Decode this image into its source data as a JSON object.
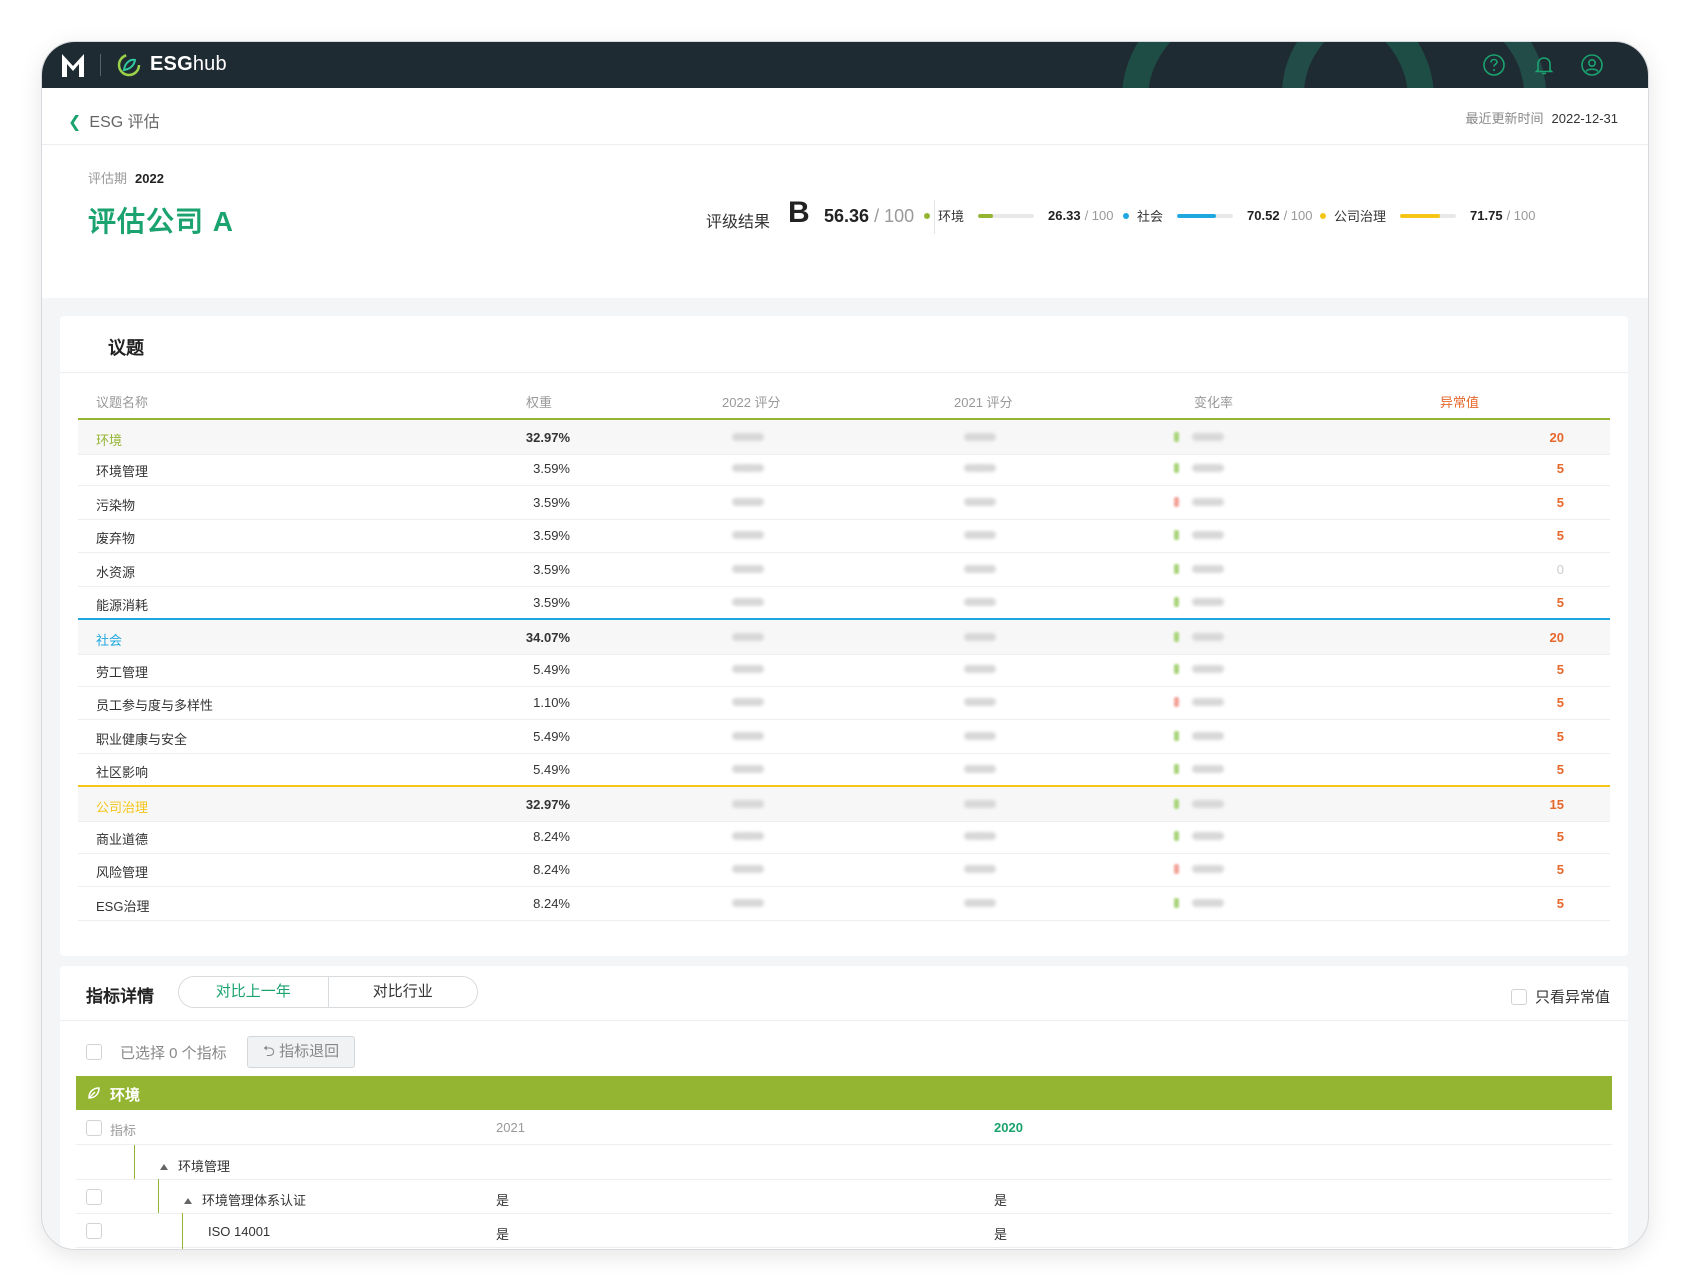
{
  "app": {
    "brand_bold": "ESG",
    "brand_light": "hub"
  },
  "topbar": {
    "icons": [
      "help-icon",
      "bell-icon",
      "user-icon"
    ]
  },
  "header": {
    "back_label": "ESG 评估",
    "updated_label": "最近更新时间",
    "updated_value": "2022-12-31",
    "period_label": "评估期",
    "period_value": "2022",
    "company": "评估公司 A",
    "rating_label": "评级结果",
    "grade": "B",
    "score": "56.36",
    "score_max": "/ 100",
    "pillars": [
      {
        "name": "环境",
        "value": "26.33",
        "max": "/ 100",
        "progress": 0.26,
        "color": "#94b531"
      },
      {
        "name": "社会",
        "value": "70.52",
        "max": "/ 100",
        "progress": 0.7,
        "color": "#1fa8e0"
      },
      {
        "name": "公司治理",
        "value": "71.75",
        "max": "/ 100",
        "progress": 0.72,
        "color": "#f5c518"
      }
    ]
  },
  "topics": {
    "title": "议题",
    "columns": [
      "议题名称",
      "权重",
      "2022 评分",
      "2021 评分",
      "变化率",
      "异常值"
    ],
    "rows": [
      {
        "name": "环境",
        "weight": "32.97%",
        "anomaly": "20",
        "group": true,
        "color": "#94b531",
        "trend": "up"
      },
      {
        "name": "环境管理",
        "weight": "3.59%",
        "anomaly": "5",
        "trend": "up"
      },
      {
        "name": "污染物",
        "weight": "3.59%",
        "anomaly": "5",
        "trend": "down"
      },
      {
        "name": "废弃物",
        "weight": "3.59%",
        "anomaly": "5",
        "trend": "up"
      },
      {
        "name": "水资源",
        "weight": "3.59%",
        "anomaly": "0",
        "trend": "up"
      },
      {
        "name": "能源消耗",
        "weight": "3.59%",
        "anomaly": "5",
        "trend": "up"
      },
      {
        "name": "社会",
        "weight": "34.07%",
        "anomaly": "20",
        "group": true,
        "color": "#1fa8e0",
        "trend": "up"
      },
      {
        "name": "劳工管理",
        "weight": "5.49%",
        "anomaly": "5",
        "trend": "up"
      },
      {
        "name": "员工参与度与多样性",
        "weight": "1.10%",
        "anomaly": "5",
        "trend": "down"
      },
      {
        "name": "职业健康与安全",
        "weight": "5.49%",
        "anomaly": "5",
        "trend": "up"
      },
      {
        "name": "社区影响",
        "weight": "5.49%",
        "anomaly": "5",
        "trend": "up"
      },
      {
        "name": "公司治理",
        "weight": "32.97%",
        "anomaly": "15",
        "group": true,
        "color": "#f5c518",
        "trend": "up"
      },
      {
        "name": "商业道德",
        "weight": "8.24%",
        "anomaly": "5",
        "trend": "up"
      },
      {
        "name": "风险管理",
        "weight": "8.24%",
        "anomaly": "5",
        "trend": "down"
      },
      {
        "name": "ESG治理",
        "weight": "8.24%",
        "anomaly": "5",
        "trend": "up"
      }
    ]
  },
  "indicators": {
    "title": "指标详情",
    "tabs": [
      "对比上一年",
      "对比行业"
    ],
    "active_tab": 0,
    "only_abnormal_label": "只看异常值",
    "selected_text": "已选择 0 个指标",
    "return_button": "指标退回",
    "section": "环境",
    "columns": [
      "指标",
      "2021",
      "2020"
    ],
    "rows": [
      {
        "name": "环境管理",
        "level": 0,
        "v2021": "",
        "v2020": ""
      },
      {
        "name": "环境管理体系认证",
        "level": 1,
        "v2021": "是",
        "v2020": "是"
      },
      {
        "name": "ISO 14001",
        "level": 2,
        "v2021": "是",
        "v2020": "是"
      }
    ]
  }
}
